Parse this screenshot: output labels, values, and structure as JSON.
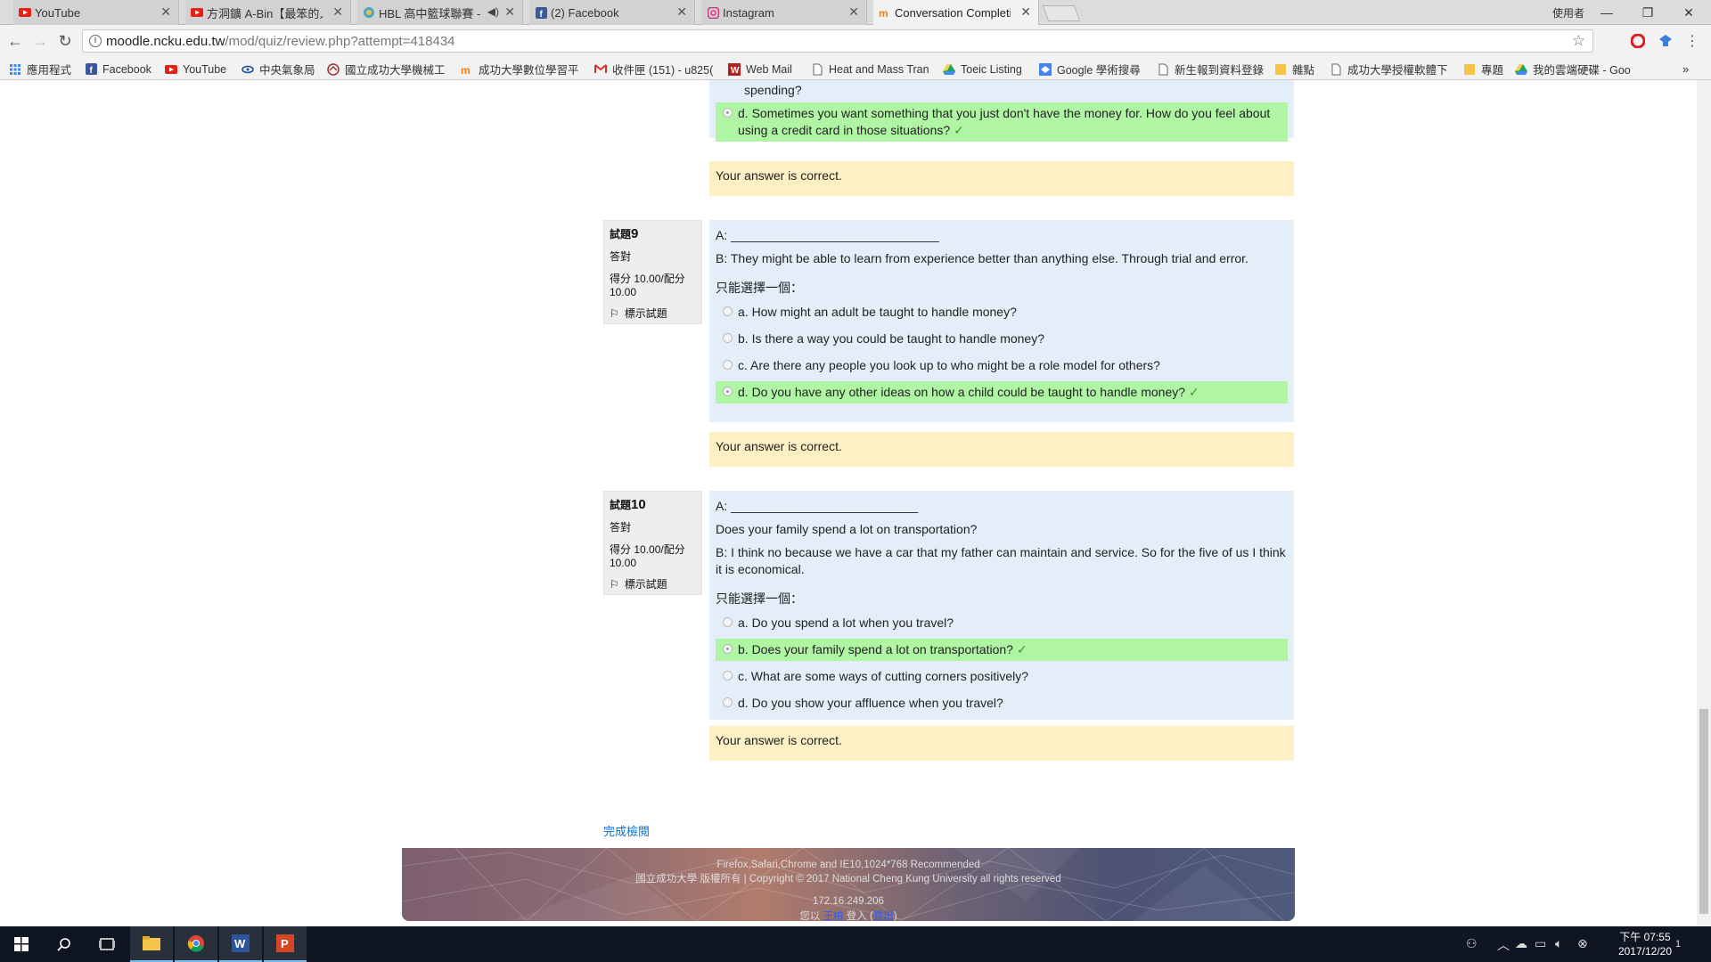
{
  "browser": {
    "tabs": [
      {
        "title": "YouTube",
        "icon": "youtube-icon"
      },
      {
        "title": "方洞鑛 A-Bin【最笨的人",
        "icon": "youtube-icon"
      },
      {
        "title": "HBL 高中籃球聯賽 - 鼎",
        "icon": "hbl-icon"
      },
      {
        "title": "(2) Facebook",
        "icon": "facebook-icon"
      },
      {
        "title": "Instagram",
        "icon": "instagram-icon"
      },
      {
        "title": "Conversation Completi",
        "icon": "moodle-icon"
      }
    ],
    "profile_label": "使用者",
    "url_host": "moodle.ncku.edu.tw",
    "url_path": "/mod/quiz/review.php?attempt=418434"
  },
  "bookmarks": [
    {
      "label": "應用程式",
      "icon": "apps-grid-icon"
    },
    {
      "label": "Facebook",
      "icon": "facebook-icon"
    },
    {
      "label": "YouTube",
      "icon": "youtube-icon"
    },
    {
      "label": "中央氣象局",
      "icon": "weather-icon"
    },
    {
      "label": "國立成功大學機械工",
      "icon": "ncku-icon"
    },
    {
      "label": "成功大學數位學習平",
      "icon": "moodle-icon"
    },
    {
      "label": "收件匣 (151) - u825(",
      "icon": "gmail-icon"
    },
    {
      "label": "Web Mail",
      "icon": "webmail-icon"
    },
    {
      "label": "Heat and Mass Tran",
      "icon": "page-icon"
    },
    {
      "label": "Toeic Listing",
      "icon": "drive-icon"
    },
    {
      "label": "Google 學術搜尋",
      "icon": "scholar-icon"
    },
    {
      "label": "新生報到資料登錄",
      "icon": "page-icon"
    },
    {
      "label": "雜點",
      "icon": "folder-icon"
    },
    {
      "label": "成功大學授權軟體下",
      "icon": "page-icon"
    },
    {
      "label": "專題",
      "icon": "folder-icon"
    },
    {
      "label": "我的雲端硬碟 - Goo",
      "icon": "drive-icon"
    }
  ],
  "quiz": {
    "prev_tail": {
      "cut_text": "spending?",
      "selected_option": "d. Sometimes you want something that you just don't have the money for. How do you feel about using a credit card in those situations?",
      "feedback": "Your answer is correct."
    },
    "questions": [
      {
        "label": "試題",
        "number": "9",
        "state": "答對",
        "grade_label": "得分 10.00/配分",
        "grade_value": "10.00",
        "flag": "標示試題",
        "line_a": "A: ______________________________",
        "line_b": "B: They might be able to learn from experience better than anything else. Through trial and error.",
        "prompt": "只能選擇一個：",
        "options": [
          {
            "text": "a. How might an adult be taught to handle money?",
            "selected": false,
            "correct": false
          },
          {
            "text": "b. Is there a way you could be taught to handle money?",
            "selected": false,
            "correct": false
          },
          {
            "text": "c. Are there any people you look up to who might be a role model for others?",
            "selected": false,
            "correct": false
          },
          {
            "text": "d. Do you have any other ideas on how a child could be taught to handle money?",
            "selected": true,
            "correct": true
          }
        ],
        "feedback": "Your answer is correct."
      },
      {
        "label": "試題",
        "number": "10",
        "state": "答對",
        "grade_label": "得分 10.00/配分",
        "grade_value": "10.00",
        "flag": "標示試題",
        "line_a": "A: ___________________________",
        "line_q": "Does your family spend a lot on transportation?",
        "line_b": "B: I think no because we have a car that my father can maintain and service. So for the five of us I think it is economical.",
        "prompt": "只能選擇一個：",
        "options": [
          {
            "text": "a. Do you spend a lot when you travel?",
            "selected": false,
            "correct": false
          },
          {
            "text": "b. Does your family spend a lot on transportation?",
            "selected": true,
            "correct": true
          },
          {
            "text": "c. What are some ways of cutting corners positively?",
            "selected": false,
            "correct": false
          },
          {
            "text": "d. Do you show your affluence when you travel?",
            "selected": false,
            "correct": false
          }
        ],
        "feedback": "Your answer is correct."
      }
    ],
    "finish_link": "完成檢閱"
  },
  "footer": {
    "line1": "Firefox,Safari,Chrome and IE10,1024*768 Recommended",
    "line2": "國立成功大學 版權所有 | Copyright © 2017 National Cheng Kung University all rights reserved",
    "line3": "172.16.249.206",
    "login_prefix": "您以",
    "login_user": "王柏",
    "login_middle": "登入 (",
    "logout": "登出",
    "login_suffix": ")"
  },
  "taskbar": {
    "time": "下午 07:55",
    "date": "2017/12/20",
    "notification_count": "1"
  },
  "colors": {
    "correct_bg": "#aff5a4",
    "question_bg": "#e3eef9",
    "feedback_bg": "#fcf0c4",
    "info_bg": "#eeeeee"
  }
}
